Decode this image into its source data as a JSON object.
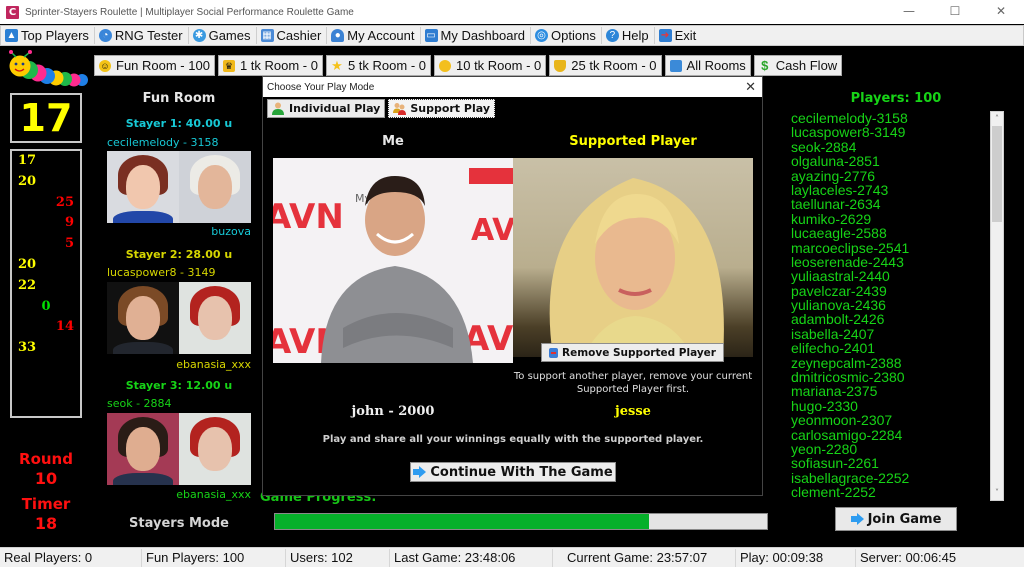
{
  "window": {
    "title": "Sprinter-Stayers Roulette | Multiplayer Social Performance Roulette Game",
    "app_icon_letter": "C",
    "controls": {
      "minimize": "—",
      "maximize": "☐",
      "close": "✕"
    }
  },
  "menu": [
    {
      "label": "Top Players",
      "icon": "podium-icon",
      "color": "#2a7fd4"
    },
    {
      "label": "RNG Tester",
      "icon": "compass-icon",
      "color": "#3a86d9"
    },
    {
      "label": "Games",
      "icon": "gear-icon",
      "color": "#3a9ae0"
    },
    {
      "label": "Cashier",
      "icon": "calculator-icon",
      "color": "#4a8ad6"
    },
    {
      "label": "My Account",
      "icon": "user-icon",
      "color": "#3b82d4"
    },
    {
      "label": "My Dashboard",
      "icon": "monitor-icon",
      "color": "#2f7dd1"
    },
    {
      "label": "Options",
      "icon": "options-icon",
      "color": "#2d8de0"
    },
    {
      "label": "Help",
      "icon": "help-icon",
      "color": "#2d86d8"
    },
    {
      "label": "Exit",
      "icon": "exit-icon",
      "color": "#2f7dd1"
    }
  ],
  "rooms": [
    {
      "label": "Fun Room - 100",
      "icon": "smiley-icon",
      "color": "#f3c316"
    },
    {
      "label": "1 tk Room - 0",
      "icon": "crown-icon",
      "color": "#f1b91a"
    },
    {
      "label": "5 tk Room - 0",
      "icon": "star-icon",
      "color": "#f5c21b"
    },
    {
      "label": "10 tk Room - 0",
      "icon": "sun-icon",
      "color": "#f3bf1d"
    },
    {
      "label": "25 tk Room - 0",
      "icon": "shield-icon",
      "color": "#e8b51a"
    },
    {
      "label": "All Rooms",
      "icon": "tv-icon",
      "color": "#3b8ad8"
    },
    {
      "label": "Cash Flow",
      "icon": "dollar-icon",
      "color": "#2aa52a"
    }
  ],
  "current_number": "17",
  "history": [
    {
      "value": "17",
      "color": "yellow"
    },
    {
      "value": "20",
      "color": "yellow"
    },
    {
      "value": "25",
      "color": "red"
    },
    {
      "value": "9",
      "color": "red"
    },
    {
      "value": "5",
      "color": "red"
    },
    {
      "value": "20",
      "color": "yellow"
    },
    {
      "value": "22",
      "color": "yellow"
    },
    {
      "value": "0",
      "color": "green"
    },
    {
      "value": "14",
      "color": "red"
    },
    {
      "value": "33",
      "color": "yellow"
    }
  ],
  "round": {
    "label": "Round",
    "value": "10"
  },
  "timer": {
    "label": "Timer",
    "value": "18"
  },
  "room_title": "Fun Room",
  "stayers": [
    {
      "title": "Stayer 1: 40.00 u",
      "user": "cecilemelody - 3158",
      "supported": "buzova",
      "color": "cyan"
    },
    {
      "title": "Stayer 2: 28.00 u",
      "user": "lucaspower8 - 3149",
      "supported": "ebanasia_xxx",
      "color": "olive"
    },
    {
      "title": "Stayer 3: 12.00 u",
      "user": "seok - 2884",
      "supported": "ebanasia_xxx",
      "color": "green"
    }
  ],
  "mode_label": "Stayers Mode",
  "progress": {
    "label": "Game Progress:",
    "percent": 76
  },
  "players": {
    "title": "Players: 100",
    "list": [
      "cecilemelody-3158",
      "lucaspower8-3149",
      "seok-2884",
      "olgaluna-2851",
      "ayazing-2776",
      "laylaceles-2743",
      "taellunar-2634",
      "kumiko-2629",
      "lucaeagle-2588",
      "marcoeclipse-2541",
      "leoserenade-2443",
      "yuliaastral-2440",
      "pavelczar-2439",
      "yulianova-2436",
      "adambolt-2426",
      "isabella-2407",
      "elifecho-2401",
      "zeynepcalm-2388",
      "dmitricosmic-2380",
      "mariana-2375",
      "hugo-2330",
      "yeonmoon-2307",
      "carlosamigo-2284",
      "yeon-2280",
      "sofiasun-2261",
      "isabellagrace-2252",
      "clement-2252"
    ],
    "scroll_up": "˄",
    "scroll_down": "˅",
    "join_label": "Join Game"
  },
  "dialog": {
    "title": "Choose Your Play Mode",
    "close": "✕",
    "tabs": [
      {
        "label": "Individual Play",
        "active": false
      },
      {
        "label": "Support Play",
        "active": true
      }
    ],
    "me_header": "Me",
    "supported_header": "Supported Player",
    "me_name": "john - 2000",
    "supported_name": "jesse",
    "remove_label": "Remove Supported Player",
    "support_note": "To support another player, remove your current Supported Player first.",
    "share_note": "Play and share all your winnings equally with the supported player.",
    "continue_label": "Continue With The Game",
    "photo_text": {
      "brand": "AVN",
      "sponsor": "MyFree"
    }
  },
  "status": [
    "Real Players: 0",
    "Fun Players: 100",
    "Users: 102",
    "Last Game: 23:48:06",
    "Current Game: 23:57:07",
    "Play: 00:09:38",
    "Server: 00:06:45"
  ]
}
